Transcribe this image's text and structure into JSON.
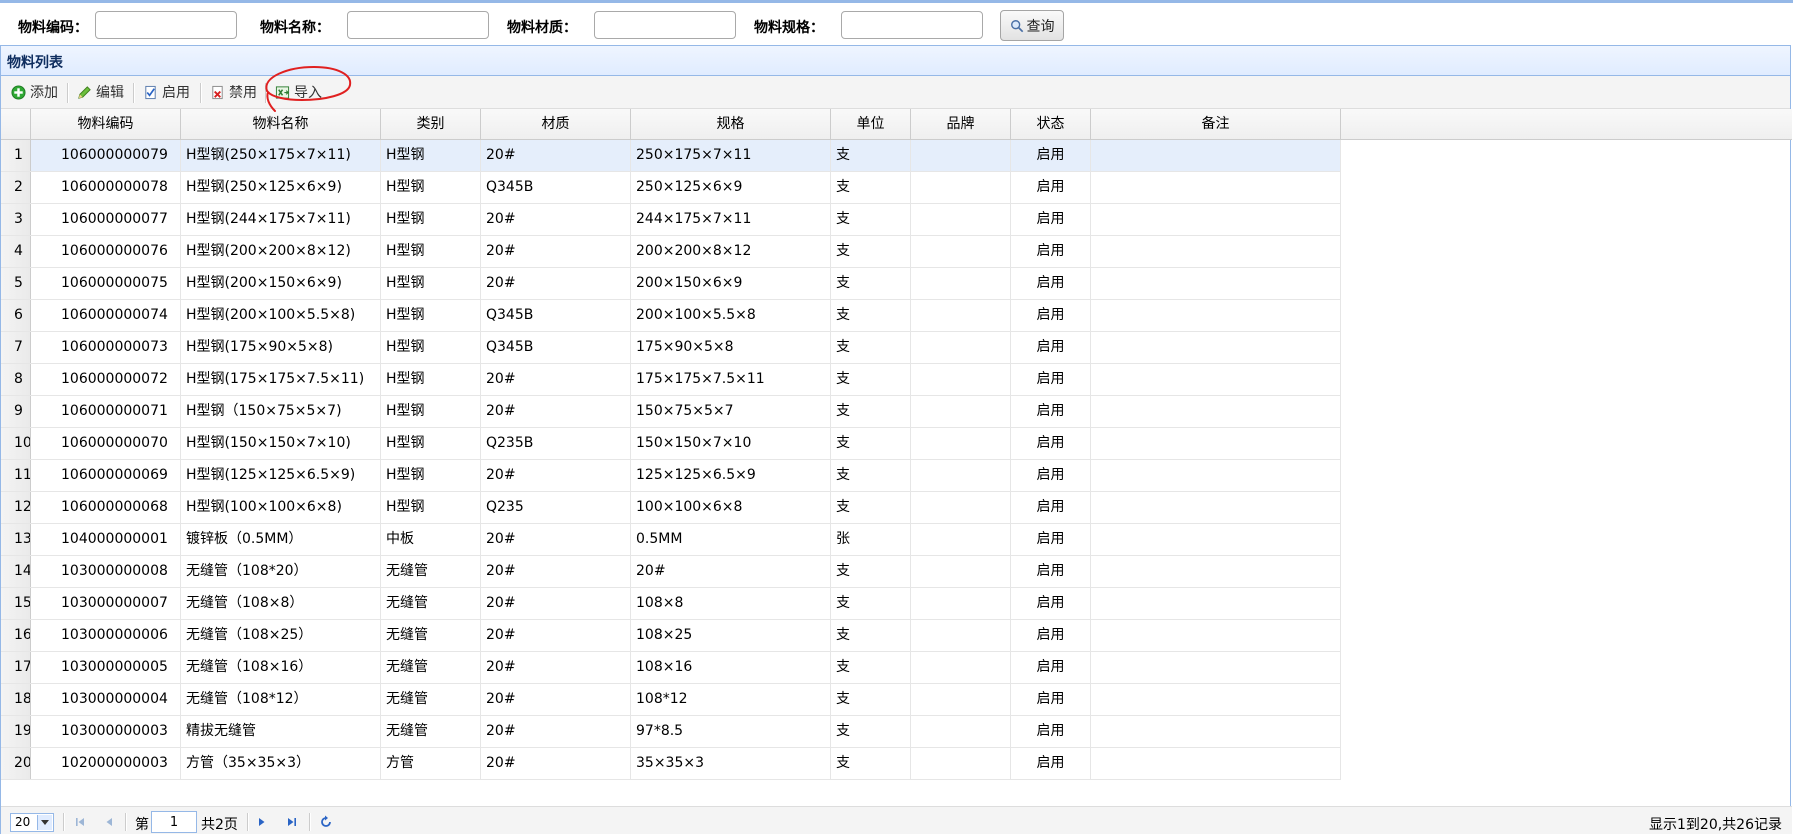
{
  "search": {
    "code_label": "物料编码：",
    "name_label": "物料名称：",
    "material_label": "物料材质：",
    "spec_label": "物料规格：",
    "button_label": "查询"
  },
  "panel": {
    "title": "物料列表"
  },
  "toolbar": {
    "add": "添加",
    "edit": "编辑",
    "enable": "启用",
    "disable": "禁用",
    "import": "导入"
  },
  "grid": {
    "columns": [
      "物料编码",
      "物料名称",
      "类别",
      "材质",
      "规格",
      "单位",
      "品牌",
      "状态",
      "备注"
    ],
    "rows": [
      {
        "n": "1",
        "code": "106000000079",
        "name": "H型钢(250×175×7×11)",
        "cat": "H型钢",
        "mat": "20#",
        "spec": "250×175×7×11",
        "unit": "支",
        "brand": "",
        "status": "启用",
        "note": ""
      },
      {
        "n": "2",
        "code": "106000000078",
        "name": "H型钢(250×125×6×9)",
        "cat": "H型钢",
        "mat": "Q345B",
        "spec": "250×125×6×9",
        "unit": "支",
        "brand": "",
        "status": "启用",
        "note": ""
      },
      {
        "n": "3",
        "code": "106000000077",
        "name": "H型钢(244×175×7×11)",
        "cat": "H型钢",
        "mat": "20#",
        "spec": "244×175×7×11",
        "unit": "支",
        "brand": "",
        "status": "启用",
        "note": ""
      },
      {
        "n": "4",
        "code": "106000000076",
        "name": "H型钢(200×200×8×12)",
        "cat": "H型钢",
        "mat": "20#",
        "spec": "200×200×8×12",
        "unit": "支",
        "brand": "",
        "status": "启用",
        "note": ""
      },
      {
        "n": "5",
        "code": "106000000075",
        "name": "H型钢(200×150×6×9)",
        "cat": "H型钢",
        "mat": "20#",
        "spec": "200×150×6×9",
        "unit": "支",
        "brand": "",
        "status": "启用",
        "note": ""
      },
      {
        "n": "6",
        "code": "106000000074",
        "name": "H型钢(200×100×5.5×8)",
        "cat": "H型钢",
        "mat": "Q345B",
        "spec": "200×100×5.5×8",
        "unit": "支",
        "brand": "",
        "status": "启用",
        "note": ""
      },
      {
        "n": "7",
        "code": "106000000073",
        "name": "H型钢(175×90×5×8)",
        "cat": "H型钢",
        "mat": "Q345B",
        "spec": "175×90×5×8",
        "unit": "支",
        "brand": "",
        "status": "启用",
        "note": ""
      },
      {
        "n": "8",
        "code": "106000000072",
        "name": "H型钢(175×175×7.5×11)",
        "cat": "H型钢",
        "mat": "20#",
        "spec": "175×175×7.5×11",
        "unit": "支",
        "brand": "",
        "status": "启用",
        "note": ""
      },
      {
        "n": "9",
        "code": "106000000071",
        "name": "H型钢（150×75×5×7)",
        "cat": "H型钢",
        "mat": "20#",
        "spec": "150×75×5×7",
        "unit": "支",
        "brand": "",
        "status": "启用",
        "note": ""
      },
      {
        "n": "10",
        "code": "106000000070",
        "name": "H型钢(150×150×7×10)",
        "cat": "H型钢",
        "mat": "Q235B",
        "spec": "150×150×7×10",
        "unit": "支",
        "brand": "",
        "status": "启用",
        "note": ""
      },
      {
        "n": "11",
        "code": "106000000069",
        "name": "H型钢(125×125×6.5×9)",
        "cat": "H型钢",
        "mat": "20#",
        "spec": "125×125×6.5×9",
        "unit": "支",
        "brand": "",
        "status": "启用",
        "note": ""
      },
      {
        "n": "12",
        "code": "106000000068",
        "name": "H型钢(100×100×6×8)",
        "cat": "H型钢",
        "mat": "Q235",
        "spec": "100×100×6×8",
        "unit": "支",
        "brand": "",
        "status": "启用",
        "note": ""
      },
      {
        "n": "13",
        "code": "104000000001",
        "name": "镀锌板（0.5MM）",
        "cat": "中板",
        "mat": "20#",
        "spec": "0.5MM",
        "unit": "张",
        "brand": "",
        "status": "启用",
        "note": ""
      },
      {
        "n": "14",
        "code": "103000000008",
        "name": "无缝管（108*20）",
        "cat": "无缝管",
        "mat": "20#",
        "spec": "20#",
        "unit": "支",
        "brand": "",
        "status": "启用",
        "note": ""
      },
      {
        "n": "15",
        "code": "103000000007",
        "name": "无缝管（108×8）",
        "cat": "无缝管",
        "mat": "20#",
        "spec": "108×8",
        "unit": "支",
        "brand": "",
        "status": "启用",
        "note": ""
      },
      {
        "n": "16",
        "code": "103000000006",
        "name": "无缝管（108×25）",
        "cat": "无缝管",
        "mat": "20#",
        "spec": "108×25",
        "unit": "支",
        "brand": "",
        "status": "启用",
        "note": ""
      },
      {
        "n": "17",
        "code": "103000000005",
        "name": "无缝管（108×16）",
        "cat": "无缝管",
        "mat": "20#",
        "spec": "108×16",
        "unit": "支",
        "brand": "",
        "status": "启用",
        "note": ""
      },
      {
        "n": "18",
        "code": "103000000004",
        "name": "无缝管（108*12）",
        "cat": "无缝管",
        "mat": "20#",
        "spec": "108*12",
        "unit": "支",
        "brand": "",
        "status": "启用",
        "note": ""
      },
      {
        "n": "19",
        "code": "103000000003",
        "name": "精拔无缝管",
        "cat": "无缝管",
        "mat": "20#",
        "spec": "97*8.5",
        "unit": "支",
        "brand": "",
        "status": "启用",
        "note": ""
      },
      {
        "n": "20",
        "code": "102000000003",
        "name": "方管（35×35×3）",
        "cat": "方管",
        "mat": "20#",
        "spec": "35×35×3",
        "unit": "支",
        "brand": "",
        "status": "启用",
        "note": ""
      }
    ]
  },
  "pager": {
    "page_size": "20",
    "page_prefix": "第",
    "page_value": "1",
    "page_total": "共2页",
    "info": "显示1到20,共26记录"
  },
  "colors": {
    "accent": "#95b8e7",
    "header_bg": "#e0ecff",
    "annotation": "#e02020"
  }
}
